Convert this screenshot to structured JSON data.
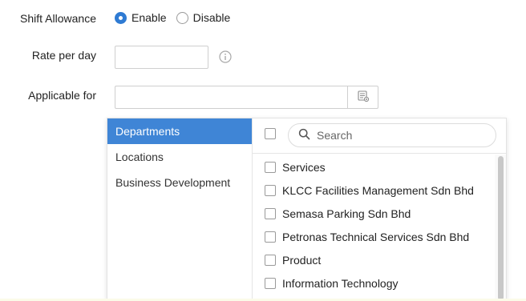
{
  "form": {
    "shift_allowance_label": "Shift Allowance",
    "radio_enable_label": "Enable",
    "radio_disable_label": "Disable",
    "radio_selected": "Enable",
    "rate_per_day_label": "Rate per day",
    "rate_value": "",
    "applicable_for_label": "Applicable for",
    "applicable_value": ""
  },
  "dropdown": {
    "categories": [
      {
        "label": "Departments",
        "active": true
      },
      {
        "label": "Locations",
        "active": false
      },
      {
        "label": "Business Development",
        "active": false
      }
    ],
    "search_placeholder": "Search",
    "items": [
      {
        "label": "Services",
        "checked": false
      },
      {
        "label": "KLCC Facilities Management Sdn Bhd",
        "checked": false
      },
      {
        "label": "Semasa Parking Sdn Bhd",
        "checked": false
      },
      {
        "label": "Petronas Technical Services Sdn Bhd",
        "checked": false
      },
      {
        "label": "Product",
        "checked": false
      },
      {
        "label": "Information Technology",
        "checked": false
      }
    ]
  },
  "colors": {
    "accent": "#3f85d6",
    "radio_checked": "#2f7bd3",
    "border": "#cfcfcf"
  },
  "icons": {
    "info": "info-icon",
    "picker": "list-picker-icon",
    "search": "search-icon"
  }
}
